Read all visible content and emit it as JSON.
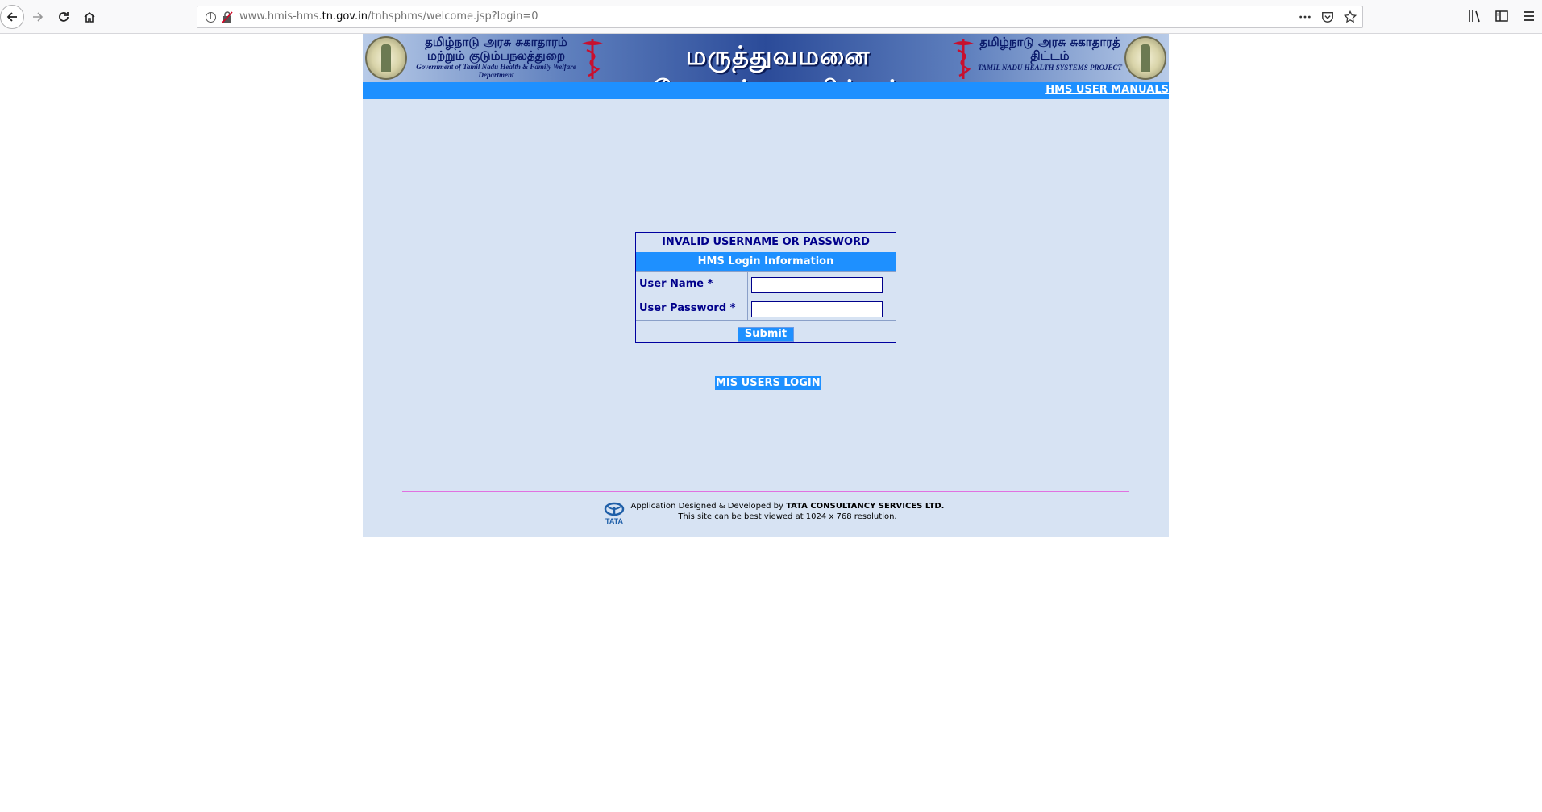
{
  "browser": {
    "url_prefix": "www.hmis-hms.",
    "url_domain": "tn.gov.in",
    "url_path": "/tnhsphms/welcome.jsp?login=0"
  },
  "banner": {
    "left_tamil": "தமிழ்நாடு அரசு சுகாதாரம் மற்றும் குடும்பநலத்துறை",
    "left_english": "Government of Tamil Nadu Health & Family Welfare Department",
    "title_tamil": "மருத்துவமனை மேலாண்மை திட்டம்",
    "right_tamil": "தமிழ்நாடு அரசு சுகாதாரத் திட்டம்",
    "right_english": "TAMIL NADU HEALTH SYSTEMS PROJECT"
  },
  "nav": {
    "manuals_link": "HMS USER MANUALS"
  },
  "login": {
    "error": "INVALID USERNAME OR PASSWORD",
    "header": "HMS Login Information",
    "username_label": "User Name *",
    "password_label": "User Password *",
    "username_value": "",
    "password_value": "",
    "submit_label": "Submit"
  },
  "mis_link": "MIS USERS LOGIN",
  "footer": {
    "designed_by": "Application Designed & Developed by",
    "company": "TATA CONSULTANCY SERVICES LTD.",
    "resolution_note": "This site can be best viewed at 1024 x 768 resolution.",
    "logo_text": "TATA"
  },
  "colors": {
    "accent": "#1e90ff",
    "page_bg": "#d7e3f3",
    "text_dark_blue": "#00008b",
    "footer_rule": "#e071e0"
  }
}
